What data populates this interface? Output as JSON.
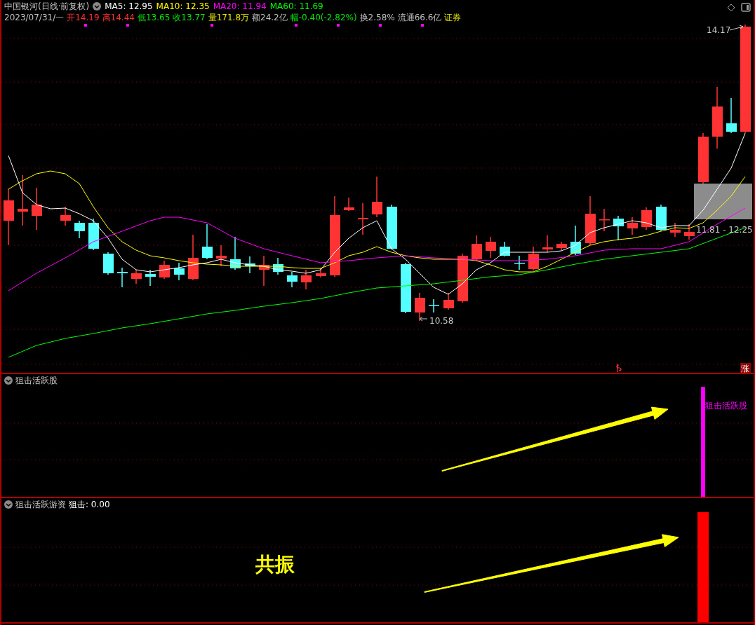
{
  "header": {
    "title": "中国银河(日线·前复权)",
    "ma": [
      {
        "label": "MA5: 12.95",
        "color": "#ffffff"
      },
      {
        "label": "MA10: 12.35",
        "color": "#ffff00"
      },
      {
        "label": "MA20: 11.94",
        "color": "#ff00ff"
      },
      {
        "label": "MA60: 11.69",
        "color": "#00ff00"
      }
    ],
    "quote": [
      {
        "text": "2023/07/31/一",
        "color": "#c0c0c0"
      },
      {
        "text": "开14.19",
        "color": "#ff3232"
      },
      {
        "text": "高14.44",
        "color": "#ff3232"
      },
      {
        "text": "低13.65",
        "color": "#00e600"
      },
      {
        "text": "收13.77",
        "color": "#00e600"
      },
      {
        "text": "量171.8万",
        "color": "#e6e600"
      },
      {
        "text": "额24.2亿",
        "color": "#c0c0c0"
      },
      {
        "text": "幅-0.40(-2.82%)",
        "color": "#00e600"
      },
      {
        "text": "换2.58%",
        "color": "#c0c0c0"
      },
      {
        "text": "流通66.6亿",
        "color": "#c0c0c0"
      },
      {
        "text": "证券",
        "color": "#e6e600"
      }
    ]
  },
  "main_chart": {
    "high_label": "14.17",
    "low_label": "10.58",
    "range_label": "11.81 - 12.25",
    "badge": "涨"
  },
  "indicator_1": {
    "title": "狙击活跃股",
    "bar_label": "狙击活跃股"
  },
  "indicator_2": {
    "title": "狙击活跃游资",
    "value": "狙击: 0.00",
    "overlay_text": "共振"
  }
}
